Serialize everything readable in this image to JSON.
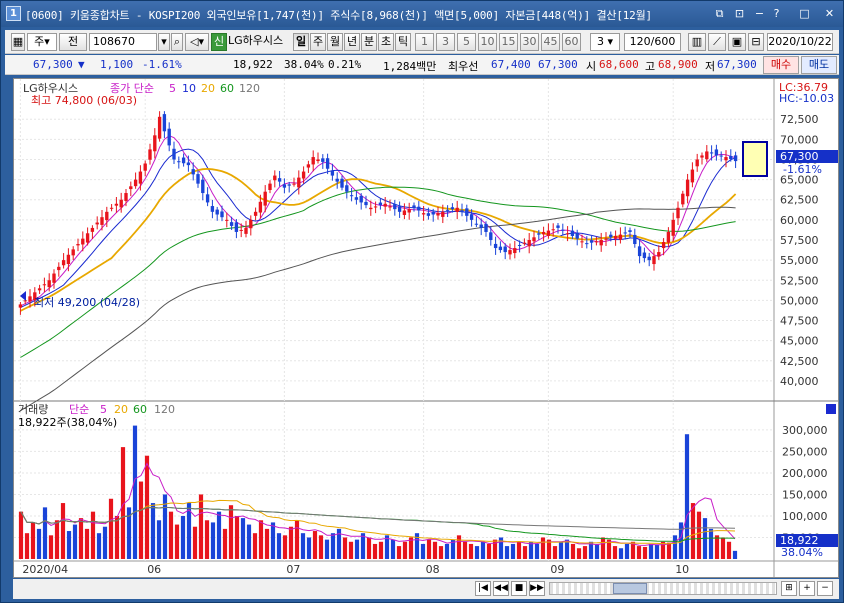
{
  "window": {
    "title": "[0600] 키움종합차트 - KOSPI200 외국인보유[1,747(천)] 주식수[8,968(천)] 액면[5,000] 자본금[448(억)] 결산[12월]",
    "icon_text": "1",
    "controls": [
      "restore-icon",
      "pin-icon",
      "minimize-icon",
      "help-icon",
      "maximize-icon",
      "close-icon"
    ]
  },
  "toolbar": {
    "market": "주",
    "prev": "전",
    "code": "108670",
    "credit": "신",
    "stock_name": "LG하우시스",
    "periods": [
      "일",
      "주",
      "월",
      "년",
      "분",
      "초",
      "틱"
    ],
    "active_period": "일",
    "minute_values": [
      "1",
      "3",
      "5",
      "10",
      "15",
      "30",
      "45",
      "60"
    ],
    "selected_minute": "3",
    "count": "120/600",
    "date": "2020/10/22"
  },
  "quote": {
    "price": "67,300",
    "change": "1,100",
    "change_pct": "-1.61%",
    "volume": "18,922",
    "vol_ratio": "38.04%",
    "turnover": "0.21%",
    "amount": "1,284백만",
    "best_ask_label": "최우선",
    "best_ask": "67,400",
    "best_bid": "67,300",
    "open_label": "시",
    "open": "68,600",
    "high_label": "고",
    "high": "68,900",
    "low_label": "저",
    "low": "67,300",
    "buy_label": "매수",
    "sell_label": "매도"
  },
  "price_panel": {
    "legend_name": "LG하우시스",
    "legend_indicator": "종가 단순",
    "ma_periods": [
      "5",
      "10",
      "20",
      "60",
      "120"
    ],
    "ma_colors": [
      "#c81ec8",
      "#1a2ad0",
      "#e8a800",
      "#14961e",
      "#555555"
    ],
    "high_note": "최고 74,800 (06/03)",
    "low_note": "최저 49,200 (04/28)",
    "lc": "LC:36.79",
    "hc": "HC:-10.03",
    "price_tag": "67,300",
    "pct_tag": "-1.61%"
  },
  "volume_panel": {
    "legend_name": "거래량",
    "legend_indicator": "단순",
    "ma_periods": [
      "5",
      "20",
      "60",
      "120"
    ],
    "current": "18,922주(38,04%)",
    "tag": "18,922",
    "tag_pct": "38.04%"
  },
  "chart_data": [
    {
      "type": "candlestick",
      "title": "LG하우시스",
      "ylim": [
        38000,
        77000
      ],
      "y_ticks": [
        40000,
        42500,
        45000,
        47500,
        50000,
        52500,
        55000,
        57500,
        60000,
        62500,
        65000,
        67500,
        70000,
        72500
      ],
      "x_labels": [
        "2020/04",
        "06",
        "07",
        "08",
        "09",
        "10"
      ],
      "close_points": [
        [
          0,
          49500
        ],
        [
          3,
          51000
        ],
        [
          6,
          52500
        ],
        [
          9,
          55000
        ],
        [
          12,
          57000
        ],
        [
          15,
          59000
        ],
        [
          18,
          61000
        ],
        [
          21,
          62500
        ],
        [
          24,
          65000
        ],
        [
          26,
          67000
        ],
        [
          28,
          70500
        ],
        [
          29,
          72800
        ],
        [
          30,
          71000
        ],
        [
          32,
          67500
        ],
        [
          35,
          66800
        ],
        [
          37,
          64500
        ],
        [
          40,
          61000
        ],
        [
          43,
          60000
        ],
        [
          45,
          58500
        ],
        [
          47,
          59000
        ],
        [
          49,
          61000
        ],
        [
          51,
          63500
        ],
        [
          53,
          65500
        ],
        [
          55,
          64000
        ],
        [
          57,
          64500
        ],
        [
          59,
          66000
        ],
        [
          61,
          67800
        ],
        [
          63,
          67200
        ],
        [
          65,
          65500
        ],
        [
          67,
          64000
        ],
        [
          70,
          62500
        ],
        [
          73,
          61500
        ],
        [
          76,
          62000
        ],
        [
          79,
          61000
        ],
        [
          82,
          61500
        ],
        [
          85,
          60500
        ],
        [
          88,
          61000
        ],
        [
          91,
          61500
        ],
        [
          94,
          60000
        ],
        [
          97,
          58500
        ],
        [
          99,
          56500
        ],
        [
          101,
          56000
        ],
        [
          103,
          56500
        ],
        [
          106,
          57500
        ],
        [
          109,
          58500
        ],
        [
          112,
          59000
        ],
        [
          115,
          58000
        ],
        [
          118,
          57000
        ],
        [
          121,
          57500
        ],
        [
          124,
          58000
        ],
        [
          127,
          58500
        ],
        [
          129,
          55500
        ],
        [
          131,
          55000
        ],
        [
          133,
          56000
        ],
        [
          135,
          58500
        ],
        [
          137,
          61500
        ],
        [
          139,
          65000
        ],
        [
          141,
          67500
        ],
        [
          143,
          68500
        ],
        [
          145,
          68000
        ],
        [
          147,
          67800
        ],
        [
          149,
          67300
        ]
      ]
    },
    {
      "type": "bar",
      "title": "거래량",
      "ylim": [
        0,
        330000
      ],
      "y_ticks": [
        50000,
        100000,
        150000,
        200000,
        250000,
        300000
      ],
      "values": [
        110000,
        60000,
        85000,
        70000,
        120000,
        55000,
        90000,
        130000,
        65000,
        80000,
        95000,
        70000,
        110000,
        60000,
        75000,
        140000,
        100000,
        260000,
        120000,
        310000,
        180000,
        240000,
        130000,
        90000,
        150000,
        110000,
        80000,
        100000,
        130000,
        75000,
        150000,
        90000,
        85000,
        110000,
        70000,
        125000,
        100000,
        95000,
        80000,
        60000,
        90000,
        70000,
        85000,
        60000,
        55000,
        75000,
        90000,
        60000,
        50000,
        65000,
        55000,
        45000,
        60000,
        70000,
        50000,
        40000,
        45000,
        60000,
        50000,
        35000,
        40000,
        55000,
        45000,
        30000,
        40000,
        50000,
        60000,
        35000,
        45000,
        40000,
        30000,
        35000,
        45000,
        55000,
        40000,
        35000,
        30000,
        40000,
        35000,
        45000,
        50000,
        30000,
        35000,
        40000,
        30000,
        40000,
        35000,
        50000,
        45000,
        30000,
        40000,
        45000,
        35000,
        25000,
        30000,
        40000,
        35000,
        50000,
        45000,
        30000,
        25000,
        35000,
        40000,
        30000,
        28000,
        35000,
        33000,
        40000,
        38000,
        55000,
        85000,
        290000,
        130000,
        110000,
        95000,
        70000,
        55000,
        50000,
        40000,
        18922
      ]
    }
  ]
}
